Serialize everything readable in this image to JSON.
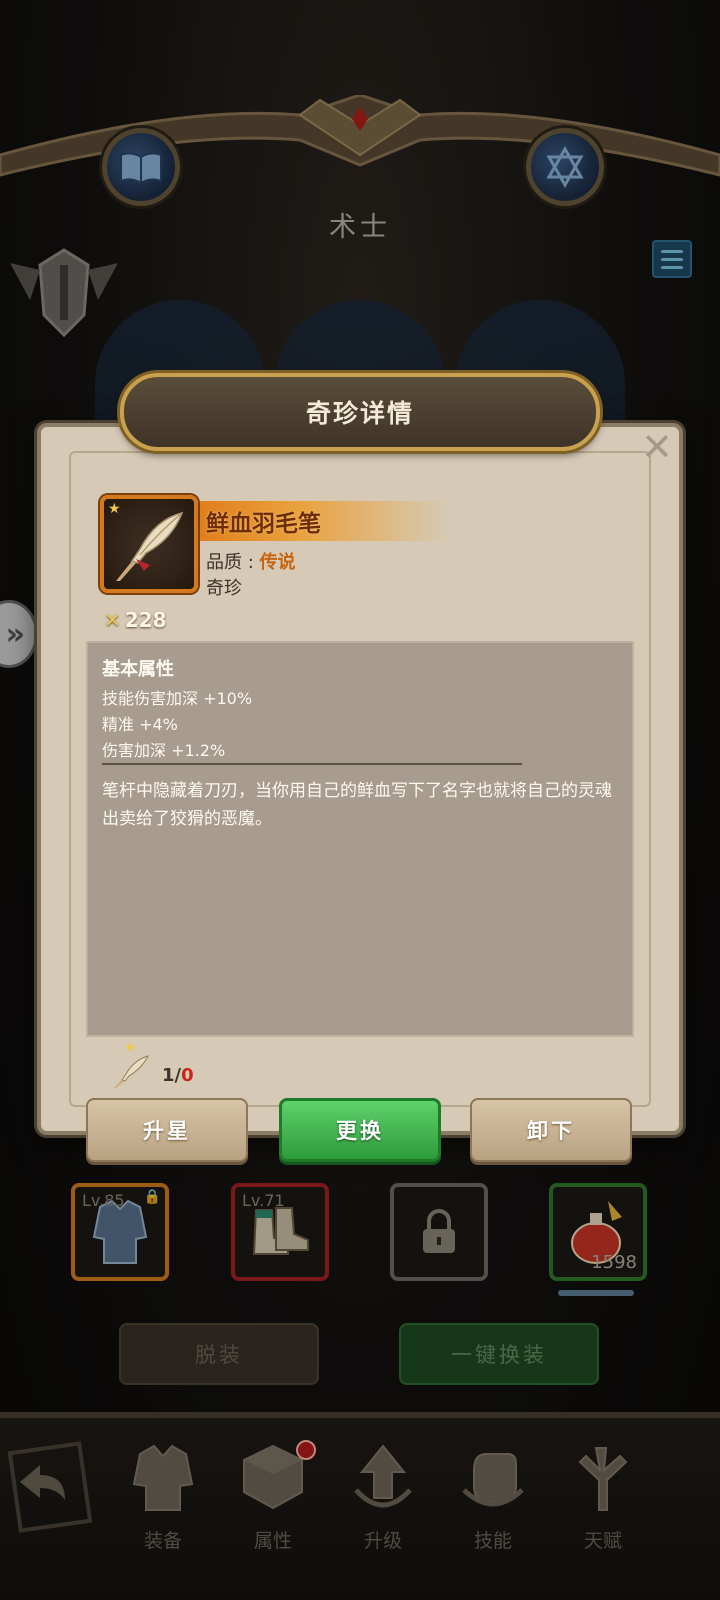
{
  "screen": {
    "class_title": "术士"
  },
  "equipment_slots": [
    {
      "level": "Lv.85",
      "locked": true,
      "frame_color": "#d37b1c"
    },
    {
      "level": "Lv.71",
      "locked": false,
      "frame_color": "#a32020"
    },
    {
      "level": "",
      "locked": true,
      "frame_color": "#6e6a60"
    },
    {
      "count": "1598",
      "frame_color": "#2e7a2a"
    }
  ],
  "actions": {
    "unequip_all": "脱装",
    "one_click_equip": "一键换装"
  },
  "bottom_nav": [
    {
      "label": "装备",
      "icon": "armor-icon"
    },
    {
      "label": "属性",
      "icon": "attribute-cube-icon"
    },
    {
      "label": "升级",
      "icon": "upgrade-arrow-icon"
    },
    {
      "label": "技能",
      "icon": "fist-icon"
    },
    {
      "label": "天赋",
      "icon": "talent-tree-icon"
    }
  ],
  "modal": {
    "title": "奇珍详情",
    "item": {
      "name": "鲜血羽毛笔",
      "quality_label": "品质 : ",
      "quality_value": "传说",
      "type": "奇珍",
      "power": "228",
      "icon": "quill-pen-icon"
    },
    "attributes": {
      "title": "基本属性",
      "lines": [
        "技能伤害加深 +10%",
        "精准 +4%",
        "伤害加深 +1.2%"
      ],
      "description": "笔杆中隐藏着刀刃，当你用自己的鲜血写下了名字也就将自己的灵魂出卖给了狡猾的恶魔。"
    },
    "star": {
      "current": "1",
      "separator": "/",
      "max": "0"
    },
    "buttons": {
      "star_up": "升星",
      "replace": "更换",
      "unequip": "卸下"
    }
  },
  "colors": {
    "legend_orange": "#c8640e",
    "green_button": "#2e9b3b",
    "parchment": "#d6cab6"
  }
}
